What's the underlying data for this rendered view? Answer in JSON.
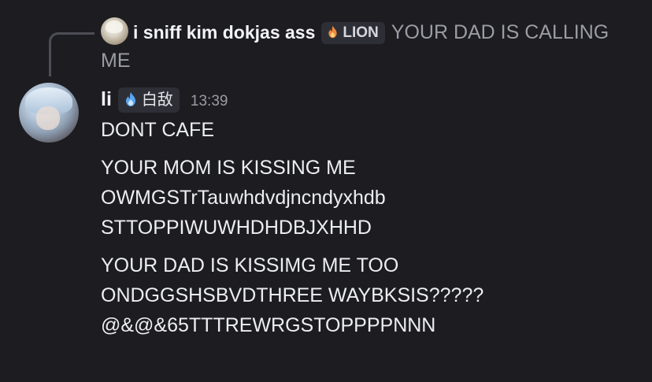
{
  "reply": {
    "author": "i sniff kim dokjas ass",
    "tag_label": "LION",
    "tag_icon": "flame-icon",
    "text": "YOUR DAD IS CALLING ME"
  },
  "message": {
    "author": "li",
    "tag_label": "白敌",
    "tag_icon": "blue-flame-icon",
    "timestamp": "13:39",
    "lines": [
      "DONT CAFE",
      "YOUR MOM IS KISSING ME",
      "OWMGSTrTauwhdvdjncndyxhdb",
      "STTOPPIWUWHDHDBJXHHD",
      "YOUR DAD IS KISSIMG ME TOO",
      "ONDGGSHSBVDTHREE WAYBKSIS?????",
      "@&@&65TTTREWRGSTOPPPPNNN"
    ]
  },
  "colors": {
    "background": "#1c1c21",
    "text": "#eceef2",
    "muted": "#9b9ca4",
    "tag_bg": "#2e2f36"
  }
}
